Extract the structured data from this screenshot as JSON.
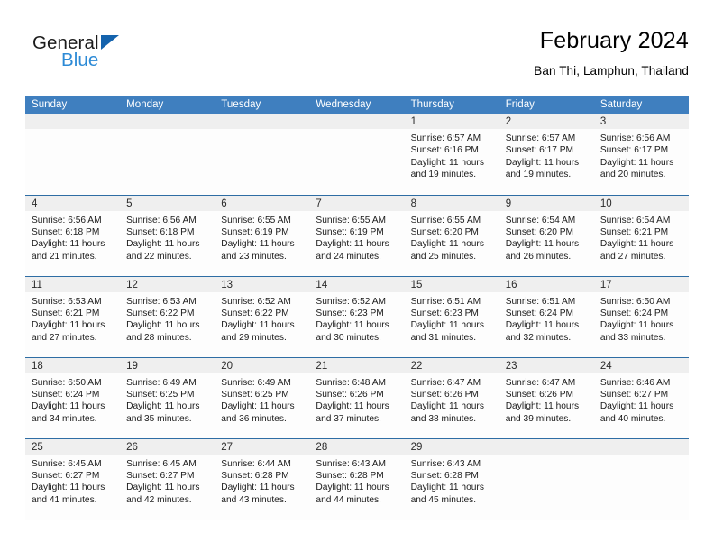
{
  "logo": {
    "word1": "General",
    "word2": "Blue",
    "triangle_color": "#1463ad",
    "blue_color": "#2c8ad6"
  },
  "header": {
    "title": "February 2024",
    "subtitle": "Ban Thi, Lamphun, Thailand"
  },
  "theme": {
    "header_bar": "#3f7fbf",
    "row_divider": "#2e6da4",
    "daynum_band": "#efefef"
  },
  "weekday_headers": [
    "Sunday",
    "Monday",
    "Tuesday",
    "Wednesday",
    "Thursday",
    "Friday",
    "Saturday"
  ],
  "weeks": [
    [
      {
        "day": "",
        "lines": []
      },
      {
        "day": "",
        "lines": []
      },
      {
        "day": "",
        "lines": []
      },
      {
        "day": "",
        "lines": []
      },
      {
        "day": "1",
        "lines": [
          "Sunrise: 6:57 AM",
          "Sunset: 6:16 PM",
          "Daylight: 11 hours",
          "and 19 minutes."
        ]
      },
      {
        "day": "2",
        "lines": [
          "Sunrise: 6:57 AM",
          "Sunset: 6:17 PM",
          "Daylight: 11 hours",
          "and 19 minutes."
        ]
      },
      {
        "day": "3",
        "lines": [
          "Sunrise: 6:56 AM",
          "Sunset: 6:17 PM",
          "Daylight: 11 hours",
          "and 20 minutes."
        ]
      }
    ],
    [
      {
        "day": "4",
        "lines": [
          "Sunrise: 6:56 AM",
          "Sunset: 6:18 PM",
          "Daylight: 11 hours",
          "and 21 minutes."
        ]
      },
      {
        "day": "5",
        "lines": [
          "Sunrise: 6:56 AM",
          "Sunset: 6:18 PM",
          "Daylight: 11 hours",
          "and 22 minutes."
        ]
      },
      {
        "day": "6",
        "lines": [
          "Sunrise: 6:55 AM",
          "Sunset: 6:19 PM",
          "Daylight: 11 hours",
          "and 23 minutes."
        ]
      },
      {
        "day": "7",
        "lines": [
          "Sunrise: 6:55 AM",
          "Sunset: 6:19 PM",
          "Daylight: 11 hours",
          "and 24 minutes."
        ]
      },
      {
        "day": "8",
        "lines": [
          "Sunrise: 6:55 AM",
          "Sunset: 6:20 PM",
          "Daylight: 11 hours",
          "and 25 minutes."
        ]
      },
      {
        "day": "9",
        "lines": [
          "Sunrise: 6:54 AM",
          "Sunset: 6:20 PM",
          "Daylight: 11 hours",
          "and 26 minutes."
        ]
      },
      {
        "day": "10",
        "lines": [
          "Sunrise: 6:54 AM",
          "Sunset: 6:21 PM",
          "Daylight: 11 hours",
          "and 27 minutes."
        ]
      }
    ],
    [
      {
        "day": "11",
        "lines": [
          "Sunrise: 6:53 AM",
          "Sunset: 6:21 PM",
          "Daylight: 11 hours",
          "and 27 minutes."
        ]
      },
      {
        "day": "12",
        "lines": [
          "Sunrise: 6:53 AM",
          "Sunset: 6:22 PM",
          "Daylight: 11 hours",
          "and 28 minutes."
        ]
      },
      {
        "day": "13",
        "lines": [
          "Sunrise: 6:52 AM",
          "Sunset: 6:22 PM",
          "Daylight: 11 hours",
          "and 29 minutes."
        ]
      },
      {
        "day": "14",
        "lines": [
          "Sunrise: 6:52 AM",
          "Sunset: 6:23 PM",
          "Daylight: 11 hours",
          "and 30 minutes."
        ]
      },
      {
        "day": "15",
        "lines": [
          "Sunrise: 6:51 AM",
          "Sunset: 6:23 PM",
          "Daylight: 11 hours",
          "and 31 minutes."
        ]
      },
      {
        "day": "16",
        "lines": [
          "Sunrise: 6:51 AM",
          "Sunset: 6:24 PM",
          "Daylight: 11 hours",
          "and 32 minutes."
        ]
      },
      {
        "day": "17",
        "lines": [
          "Sunrise: 6:50 AM",
          "Sunset: 6:24 PM",
          "Daylight: 11 hours",
          "and 33 minutes."
        ]
      }
    ],
    [
      {
        "day": "18",
        "lines": [
          "Sunrise: 6:50 AM",
          "Sunset: 6:24 PM",
          "Daylight: 11 hours",
          "and 34 minutes."
        ]
      },
      {
        "day": "19",
        "lines": [
          "Sunrise: 6:49 AM",
          "Sunset: 6:25 PM",
          "Daylight: 11 hours",
          "and 35 minutes."
        ]
      },
      {
        "day": "20",
        "lines": [
          "Sunrise: 6:49 AM",
          "Sunset: 6:25 PM",
          "Daylight: 11 hours",
          "and 36 minutes."
        ]
      },
      {
        "day": "21",
        "lines": [
          "Sunrise: 6:48 AM",
          "Sunset: 6:26 PM",
          "Daylight: 11 hours",
          "and 37 minutes."
        ]
      },
      {
        "day": "22",
        "lines": [
          "Sunrise: 6:47 AM",
          "Sunset: 6:26 PM",
          "Daylight: 11 hours",
          "and 38 minutes."
        ]
      },
      {
        "day": "23",
        "lines": [
          "Sunrise: 6:47 AM",
          "Sunset: 6:26 PM",
          "Daylight: 11 hours",
          "and 39 minutes."
        ]
      },
      {
        "day": "24",
        "lines": [
          "Sunrise: 6:46 AM",
          "Sunset: 6:27 PM",
          "Daylight: 11 hours",
          "and 40 minutes."
        ]
      }
    ],
    [
      {
        "day": "25",
        "lines": [
          "Sunrise: 6:45 AM",
          "Sunset: 6:27 PM",
          "Daylight: 11 hours",
          "and 41 minutes."
        ]
      },
      {
        "day": "26",
        "lines": [
          "Sunrise: 6:45 AM",
          "Sunset: 6:27 PM",
          "Daylight: 11 hours",
          "and 42 minutes."
        ]
      },
      {
        "day": "27",
        "lines": [
          "Sunrise: 6:44 AM",
          "Sunset: 6:28 PM",
          "Daylight: 11 hours",
          "and 43 minutes."
        ]
      },
      {
        "day": "28",
        "lines": [
          "Sunrise: 6:43 AM",
          "Sunset: 6:28 PM",
          "Daylight: 11 hours",
          "and 44 minutes."
        ]
      },
      {
        "day": "29",
        "lines": [
          "Sunrise: 6:43 AM",
          "Sunset: 6:28 PM",
          "Daylight: 11 hours",
          "and 45 minutes."
        ]
      },
      {
        "day": "",
        "lines": []
      },
      {
        "day": "",
        "lines": []
      }
    ]
  ]
}
